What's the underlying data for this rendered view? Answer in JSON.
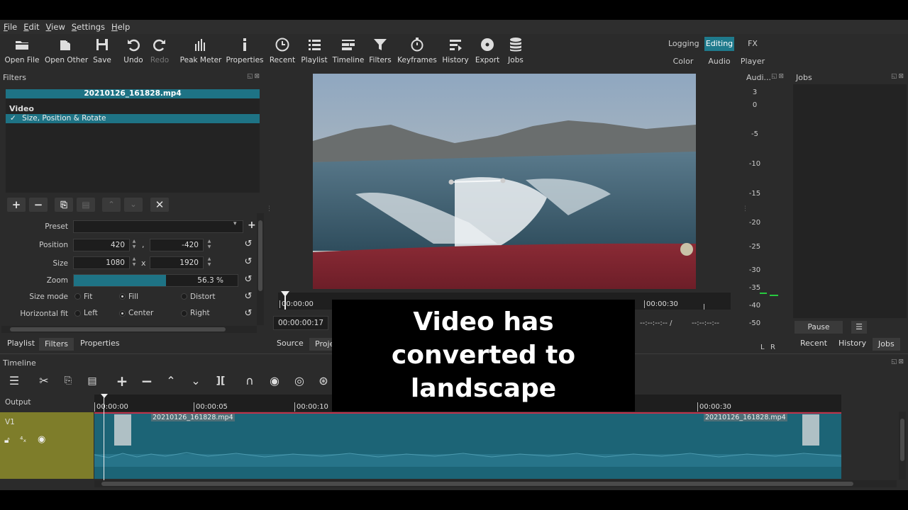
{
  "menu": [
    "File",
    "Edit",
    "View",
    "Settings",
    "Help"
  ],
  "toolbar": {
    "open_file": "Open File",
    "open_other": "Open Other",
    "save": "Save",
    "undo": "Undo",
    "redo": "Redo",
    "peak_meter": "Peak Meter",
    "properties": "Properties",
    "recent": "Recent",
    "playlist": "Playlist",
    "timeline": "Timeline",
    "filters": "Filters",
    "keyframes": "Keyframes",
    "history": "History",
    "export": "Export",
    "jobs": "Jobs"
  },
  "layouts": {
    "logging": "Logging",
    "editing": "Editing",
    "fx": "FX",
    "color": "Color",
    "audio": "Audio",
    "player": "Player",
    "active": "Editing"
  },
  "filters_panel": {
    "title": "Filters",
    "clip_name": "20210126_161828.mp4",
    "category": "Video",
    "filter_check": "✓",
    "filter_name": "Size, Position & Rotate",
    "preset_label": "Preset",
    "preset_value": "",
    "position_label": "Position",
    "position_x": "420",
    "position_y": "-420",
    "position_sep": ",",
    "size_label": "Size",
    "size_w": "1080",
    "size_h": "1920",
    "size_sep": "x",
    "zoom_label": "Zoom",
    "zoom_value": "56.3 %",
    "zoom_fraction": 0.563,
    "size_mode_label": "Size mode",
    "size_mode_options": [
      "Fit",
      "Fill",
      "Distort"
    ],
    "size_mode_selected": "Fill",
    "hfit_label": "Horizontal fit",
    "hfit_options": [
      "Left",
      "Center",
      "Right"
    ],
    "hfit_selected": "Center"
  },
  "left_tabs": [
    "Playlist",
    "Filters",
    "Properties"
  ],
  "left_tab_active": "Filters",
  "player": {
    "scrub_start": "00:00:00",
    "scrub_end": "00:00:30",
    "current_timecode": "00:00:00:17",
    "in_point": "--:--:--:-- /",
    "out_point": "--:--:--:--",
    "tabs": [
      "Source",
      "Proje"
    ],
    "active_tab": "Source"
  },
  "audio_meter": {
    "title": "Audi...",
    "scale": [
      "3",
      "0",
      "-5",
      "-10",
      "-15",
      "-20",
      "-25",
      "-30",
      "-35",
      "-40",
      "-50"
    ],
    "channels": [
      "L",
      "R"
    ],
    "level_color": "#27c93f"
  },
  "jobs_panel": {
    "title": "Jobs",
    "pause": "Pause",
    "menu_icon": "☰",
    "tabs": [
      "Recent",
      "History",
      "Jobs"
    ],
    "active_tab": "Jobs"
  },
  "timeline": {
    "title": "Timeline",
    "output_label": "Output",
    "track_name": "V1",
    "ticks": [
      "00:00:00",
      "00:00:05",
      "00:00:10",
      "00:00:30"
    ],
    "clip_name_start": "20210126_161828.mp4",
    "clip_name_end": "20210126_161828.mp4"
  },
  "caption": {
    "line1": "Video has",
    "line2": "converted to",
    "line3": "landscape"
  },
  "colors": {
    "accent": "#1e7385",
    "track_header": "#7e7d2a",
    "clip": "#1c6476",
    "background": "#2b2b2b"
  }
}
